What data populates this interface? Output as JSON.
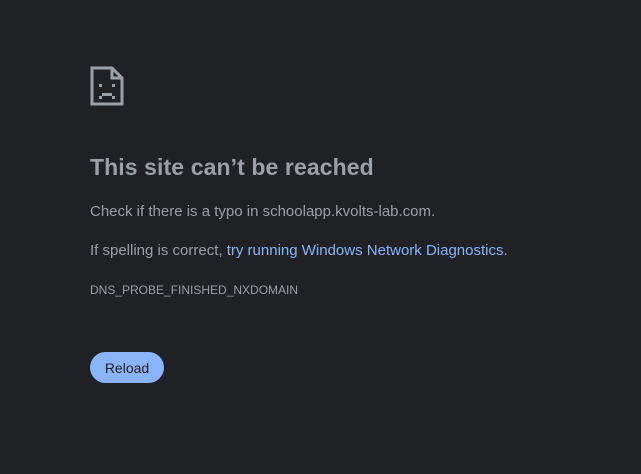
{
  "icon": "sad-page-icon",
  "title": "This site can’t be reached",
  "check_typo": {
    "prefix": "Check if there is a typo in ",
    "domain": "schoolapp.kvolts-lab.com",
    "suffix": "."
  },
  "spelling": {
    "prefix": "If spelling is correct, ",
    "link_text": "try running Windows Network Diagnostics",
    "suffix": "."
  },
  "error_code": "DNS_PROBE_FINISHED_NXDOMAIN",
  "reload_label": "Reload",
  "colors": {
    "background": "#202124",
    "text": "#9aa0a6",
    "link": "#8ab4f8",
    "button": "#8ab4f8"
  }
}
